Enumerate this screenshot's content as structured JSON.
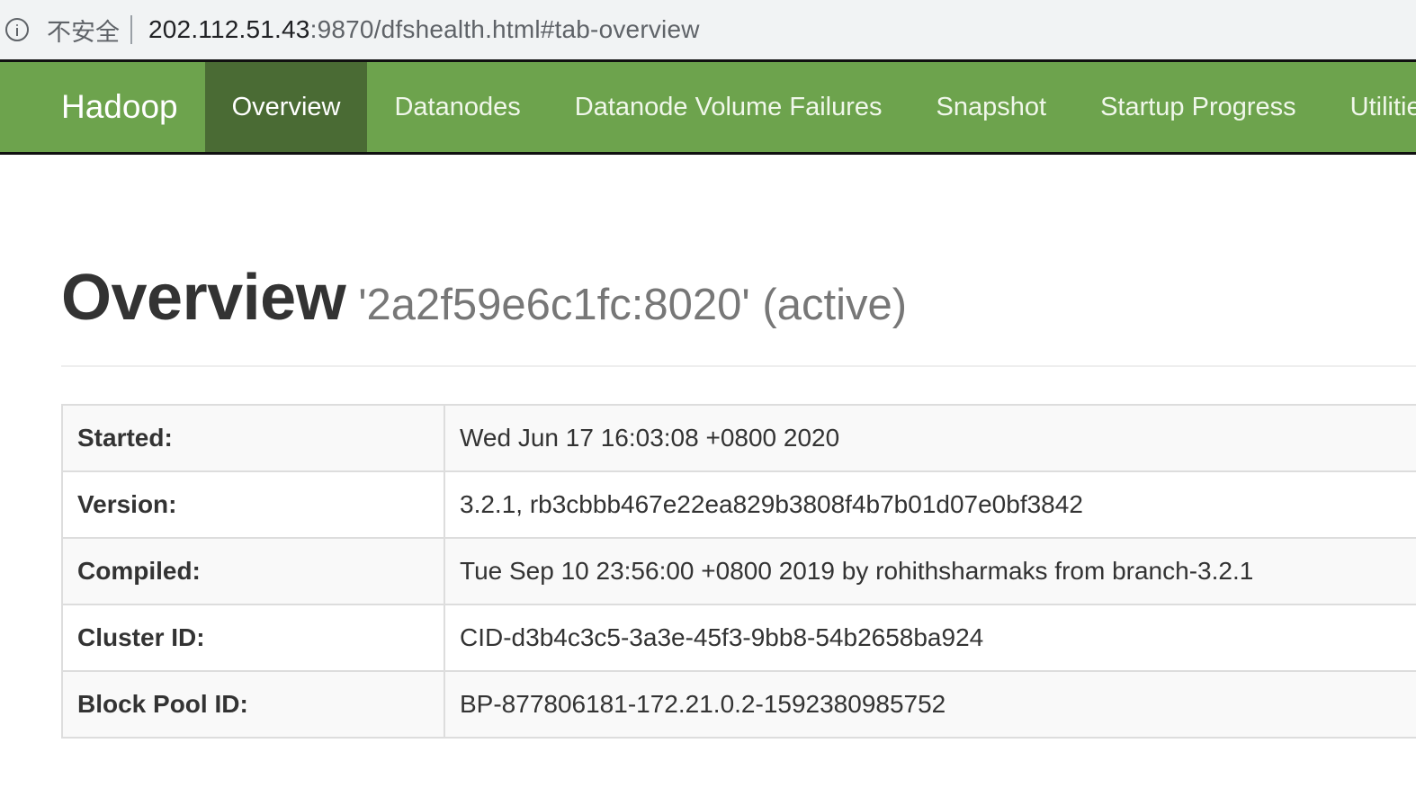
{
  "browser": {
    "security_label": "不安全",
    "url_host": "202.112.51.43",
    "url_rest": ":9870/dfshealth.html#tab-overview",
    "info_icon": "info-icon"
  },
  "navbar": {
    "brand": "Hadoop",
    "bg_color": "#6da34d",
    "active_bg_color": "#4a6b34",
    "items": [
      {
        "label": "Overview",
        "active": true
      },
      {
        "label": "Datanodes",
        "active": false
      },
      {
        "label": "Datanode Volume Failures",
        "active": false
      },
      {
        "label": "Snapshot",
        "active": false
      },
      {
        "label": "Startup Progress",
        "active": false
      },
      {
        "label": "Utilitie",
        "active": false
      }
    ]
  },
  "header": {
    "title": "Overview",
    "subtitle": "'2a2f59e6c1fc:8020' (active)"
  },
  "info_table": {
    "rows": [
      {
        "label": "Started:",
        "value": "Wed Jun 17 16:03:08 +0800 2020"
      },
      {
        "label": "Version:",
        "value": "3.2.1, rb3cbbb467e22ea829b3808f4b7b01d07e0bf3842"
      },
      {
        "label": "Compiled:",
        "value": "Tue Sep 10 23:56:00 +0800 2019 by rohithsharmaks from branch-3.2.1"
      },
      {
        "label": "Cluster ID:",
        "value": "CID-d3b4c3c5-3a3e-45f3-9bb8-54b2658ba924"
      },
      {
        "label": "Block Pool ID:",
        "value": "BP-877806181-172.21.0.2-1592380985752"
      }
    ]
  }
}
